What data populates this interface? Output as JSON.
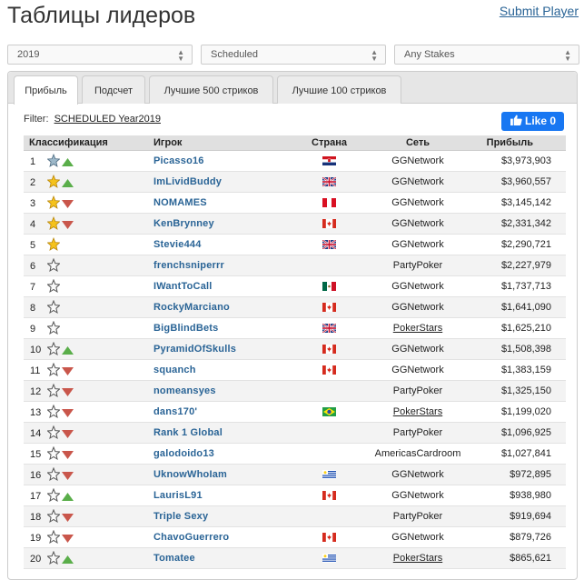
{
  "page": {
    "title": "Таблицы лидеров",
    "submit_link": "Submit Player"
  },
  "filters": {
    "year": "2019",
    "type": "Scheduled",
    "stakes": "Any Stakes"
  },
  "tabs": [
    {
      "label": "Прибыль",
      "active": true
    },
    {
      "label": "Подсчет",
      "active": false
    },
    {
      "label": "Лучшие 500 стриков",
      "active": false
    },
    {
      "label": "Лучшие 100 стриков",
      "active": false
    }
  ],
  "filter_line": {
    "label": "Filter:",
    "value": "SCHEDULED Year2019"
  },
  "like_button": {
    "label": "Like 0"
  },
  "table": {
    "headers": {
      "rank": "Классификация",
      "player": "Игрок",
      "country": "Страна",
      "network": "Сеть",
      "profit": "Прибыль"
    },
    "rows": [
      {
        "rank": "1",
        "star": "silver-blue",
        "trend": "up",
        "player": "Picasso16",
        "flag": "HR",
        "network": "GGNetwork",
        "network_link": false,
        "profit": "$3,973,903"
      },
      {
        "rank": "2",
        "star": "gold",
        "trend": "up",
        "player": "ImLividBuddy",
        "flag": "GB",
        "network": "GGNetwork",
        "network_link": false,
        "profit": "$3,960,557"
      },
      {
        "rank": "3",
        "star": "gold",
        "trend": "down",
        "player": "NOMAMES",
        "flag": "PE",
        "network": "GGNetwork",
        "network_link": false,
        "profit": "$3,145,142"
      },
      {
        "rank": "4",
        "star": "gold",
        "trend": "down",
        "player": "KenBrynney",
        "flag": "CA",
        "network": "GGNetwork",
        "network_link": false,
        "profit": "$2,331,342"
      },
      {
        "rank": "5",
        "star": "gold",
        "trend": "none",
        "player": "Stevie444",
        "flag": "GB",
        "network": "GGNetwork",
        "network_link": false,
        "profit": "$2,290,721"
      },
      {
        "rank": "6",
        "star": "outline",
        "trend": "none",
        "player": "frenchsniperrr",
        "flag": "",
        "network": "PartyPoker",
        "network_link": false,
        "profit": "$2,227,979"
      },
      {
        "rank": "7",
        "star": "outline",
        "trend": "none",
        "player": "IWantToCall",
        "flag": "MX",
        "network": "GGNetwork",
        "network_link": false,
        "profit": "$1,737,713"
      },
      {
        "rank": "8",
        "star": "outline",
        "trend": "none",
        "player": "RockyMarciano",
        "flag": "CA",
        "network": "GGNetwork",
        "network_link": false,
        "profit": "$1,641,090"
      },
      {
        "rank": "9",
        "star": "outline",
        "trend": "none",
        "player": "BigBlindBets",
        "flag": "GB",
        "network": "PokerStars",
        "network_link": true,
        "profit": "$1,625,210"
      },
      {
        "rank": "10",
        "star": "outline",
        "trend": "up",
        "player": "PyramidOfSkulls",
        "flag": "CA",
        "network": "GGNetwork",
        "network_link": false,
        "profit": "$1,508,398"
      },
      {
        "rank": "11",
        "star": "outline",
        "trend": "down",
        "player": "squanch",
        "flag": "CA",
        "network": "GGNetwork",
        "network_link": false,
        "profit": "$1,383,159"
      },
      {
        "rank": "12",
        "star": "outline",
        "trend": "down",
        "player": "nomeansyes",
        "flag": "",
        "network": "PartyPoker",
        "network_link": false,
        "profit": "$1,325,150"
      },
      {
        "rank": "13",
        "star": "outline",
        "trend": "down",
        "player": "dans170'",
        "flag": "BR",
        "network": "PokerStars",
        "network_link": true,
        "profit": "$1,199,020"
      },
      {
        "rank": "14",
        "star": "outline",
        "trend": "down",
        "player": "Rank 1 Global",
        "flag": "",
        "network": "PartyPoker",
        "network_link": false,
        "profit": "$1,096,925"
      },
      {
        "rank": "15",
        "star": "outline",
        "trend": "down",
        "player": "galodoido13",
        "flag": "",
        "network": "AmericasCardroom",
        "network_link": false,
        "profit": "$1,027,841"
      },
      {
        "rank": "16",
        "star": "outline",
        "trend": "down",
        "player": "UknowWhoIam",
        "flag": "UY",
        "network": "GGNetwork",
        "network_link": false,
        "profit": "$972,895"
      },
      {
        "rank": "17",
        "star": "outline",
        "trend": "up",
        "player": "LaurisL91",
        "flag": "CA",
        "network": "GGNetwork",
        "network_link": false,
        "profit": "$938,980"
      },
      {
        "rank": "18",
        "star": "outline",
        "trend": "down",
        "player": "Triple Sexy",
        "flag": "",
        "network": "PartyPoker",
        "network_link": false,
        "profit": "$919,694"
      },
      {
        "rank": "19",
        "star": "outline",
        "trend": "down",
        "player": "ChavoGuerrero",
        "flag": "CA",
        "network": "GGNetwork",
        "network_link": false,
        "profit": "$879,726"
      },
      {
        "rank": "20",
        "star": "outline",
        "trend": "up",
        "player": "Tomatee",
        "flag": "UY",
        "network": "PokerStars",
        "network_link": true,
        "profit": "$865,621"
      }
    ]
  }
}
